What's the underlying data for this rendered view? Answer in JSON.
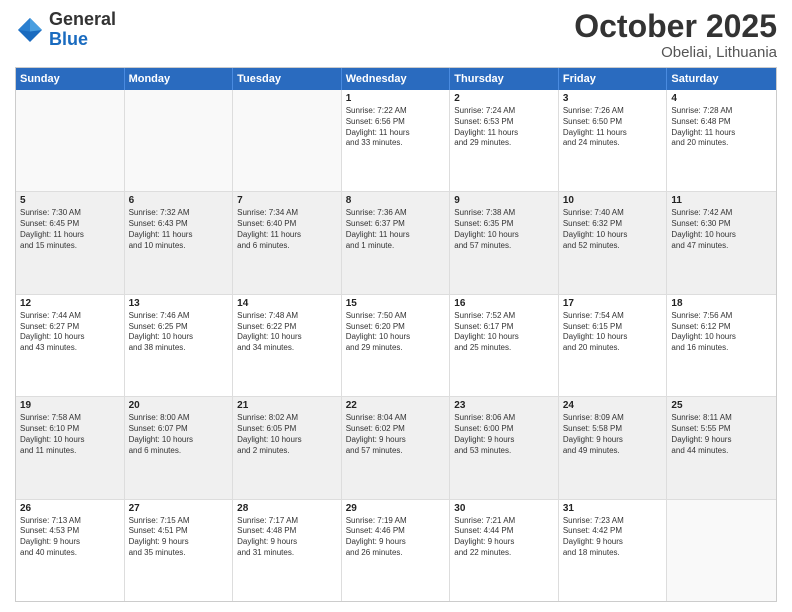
{
  "header": {
    "logo_general": "General",
    "logo_blue": "Blue",
    "month_title": "October 2025",
    "location": "Obeliai, Lithuania"
  },
  "weekdays": [
    "Sunday",
    "Monday",
    "Tuesday",
    "Wednesday",
    "Thursday",
    "Friday",
    "Saturday"
  ],
  "rows": [
    [
      {
        "day": "",
        "text": "",
        "empty": true
      },
      {
        "day": "",
        "text": "",
        "empty": true
      },
      {
        "day": "",
        "text": "",
        "empty": true
      },
      {
        "day": "1",
        "text": "Sunrise: 7:22 AM\nSunset: 6:56 PM\nDaylight: 11 hours\nand 33 minutes."
      },
      {
        "day": "2",
        "text": "Sunrise: 7:24 AM\nSunset: 6:53 PM\nDaylight: 11 hours\nand 29 minutes."
      },
      {
        "day": "3",
        "text": "Sunrise: 7:26 AM\nSunset: 6:50 PM\nDaylight: 11 hours\nand 24 minutes."
      },
      {
        "day": "4",
        "text": "Sunrise: 7:28 AM\nSunset: 6:48 PM\nDaylight: 11 hours\nand 20 minutes."
      }
    ],
    [
      {
        "day": "5",
        "text": "Sunrise: 7:30 AM\nSunset: 6:45 PM\nDaylight: 11 hours\nand 15 minutes.",
        "shaded": true
      },
      {
        "day": "6",
        "text": "Sunrise: 7:32 AM\nSunset: 6:43 PM\nDaylight: 11 hours\nand 10 minutes.",
        "shaded": true
      },
      {
        "day": "7",
        "text": "Sunrise: 7:34 AM\nSunset: 6:40 PM\nDaylight: 11 hours\nand 6 minutes.",
        "shaded": true
      },
      {
        "day": "8",
        "text": "Sunrise: 7:36 AM\nSunset: 6:37 PM\nDaylight: 11 hours\nand 1 minute.",
        "shaded": true
      },
      {
        "day": "9",
        "text": "Sunrise: 7:38 AM\nSunset: 6:35 PM\nDaylight: 10 hours\nand 57 minutes.",
        "shaded": true
      },
      {
        "day": "10",
        "text": "Sunrise: 7:40 AM\nSunset: 6:32 PM\nDaylight: 10 hours\nand 52 minutes.",
        "shaded": true
      },
      {
        "day": "11",
        "text": "Sunrise: 7:42 AM\nSunset: 6:30 PM\nDaylight: 10 hours\nand 47 minutes.",
        "shaded": true
      }
    ],
    [
      {
        "day": "12",
        "text": "Sunrise: 7:44 AM\nSunset: 6:27 PM\nDaylight: 10 hours\nand 43 minutes."
      },
      {
        "day": "13",
        "text": "Sunrise: 7:46 AM\nSunset: 6:25 PM\nDaylight: 10 hours\nand 38 minutes."
      },
      {
        "day": "14",
        "text": "Sunrise: 7:48 AM\nSunset: 6:22 PM\nDaylight: 10 hours\nand 34 minutes."
      },
      {
        "day": "15",
        "text": "Sunrise: 7:50 AM\nSunset: 6:20 PM\nDaylight: 10 hours\nand 29 minutes."
      },
      {
        "day": "16",
        "text": "Sunrise: 7:52 AM\nSunset: 6:17 PM\nDaylight: 10 hours\nand 25 minutes."
      },
      {
        "day": "17",
        "text": "Sunrise: 7:54 AM\nSunset: 6:15 PM\nDaylight: 10 hours\nand 20 minutes."
      },
      {
        "day": "18",
        "text": "Sunrise: 7:56 AM\nSunset: 6:12 PM\nDaylight: 10 hours\nand 16 minutes."
      }
    ],
    [
      {
        "day": "19",
        "text": "Sunrise: 7:58 AM\nSunset: 6:10 PM\nDaylight: 10 hours\nand 11 minutes.",
        "shaded": true
      },
      {
        "day": "20",
        "text": "Sunrise: 8:00 AM\nSunset: 6:07 PM\nDaylight: 10 hours\nand 6 minutes.",
        "shaded": true
      },
      {
        "day": "21",
        "text": "Sunrise: 8:02 AM\nSunset: 6:05 PM\nDaylight: 10 hours\nand 2 minutes.",
        "shaded": true
      },
      {
        "day": "22",
        "text": "Sunrise: 8:04 AM\nSunset: 6:02 PM\nDaylight: 9 hours\nand 57 minutes.",
        "shaded": true
      },
      {
        "day": "23",
        "text": "Sunrise: 8:06 AM\nSunset: 6:00 PM\nDaylight: 9 hours\nand 53 minutes.",
        "shaded": true
      },
      {
        "day": "24",
        "text": "Sunrise: 8:09 AM\nSunset: 5:58 PM\nDaylight: 9 hours\nand 49 minutes.",
        "shaded": true
      },
      {
        "day": "25",
        "text": "Sunrise: 8:11 AM\nSunset: 5:55 PM\nDaylight: 9 hours\nand 44 minutes.",
        "shaded": true
      }
    ],
    [
      {
        "day": "26",
        "text": "Sunrise: 7:13 AM\nSunset: 4:53 PM\nDaylight: 9 hours\nand 40 minutes."
      },
      {
        "day": "27",
        "text": "Sunrise: 7:15 AM\nSunset: 4:51 PM\nDaylight: 9 hours\nand 35 minutes."
      },
      {
        "day": "28",
        "text": "Sunrise: 7:17 AM\nSunset: 4:48 PM\nDaylight: 9 hours\nand 31 minutes."
      },
      {
        "day": "29",
        "text": "Sunrise: 7:19 AM\nSunset: 4:46 PM\nDaylight: 9 hours\nand 26 minutes."
      },
      {
        "day": "30",
        "text": "Sunrise: 7:21 AM\nSunset: 4:44 PM\nDaylight: 9 hours\nand 22 minutes."
      },
      {
        "day": "31",
        "text": "Sunrise: 7:23 AM\nSunset: 4:42 PM\nDaylight: 9 hours\nand 18 minutes."
      },
      {
        "day": "",
        "text": "",
        "empty": true
      }
    ]
  ]
}
